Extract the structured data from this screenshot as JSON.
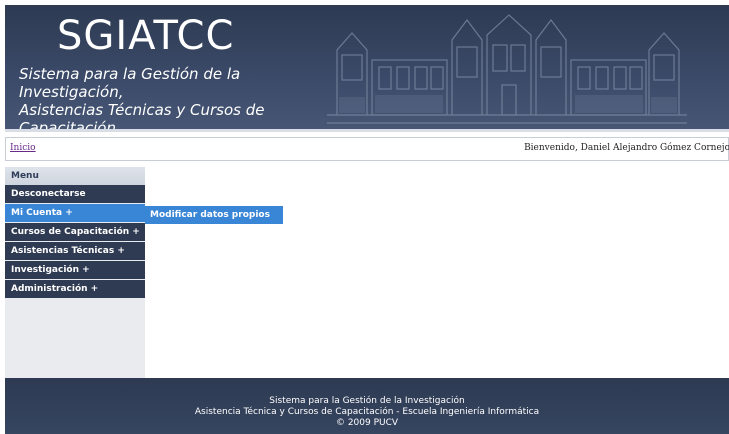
{
  "header": {
    "logo": "SGIATCC",
    "subtitle_line1": "Sistema para la Gestión de la Investigación,",
    "subtitle_line2": "Asistencias Técnicas y Cursos de Capacitación"
  },
  "breadcrumb": {
    "home_label": "Inicio",
    "welcome_text": "Bienvenido, Daniel Alejandro Gómez Cornejo"
  },
  "sidebar": {
    "title": "Menu",
    "items": [
      {
        "label": "Desconectarse",
        "active": false
      },
      {
        "label": "Mi Cuenta +",
        "active": true
      },
      {
        "label": "Cursos de Capacitación +",
        "active": false
      },
      {
        "label": "Asistencias Técnicas +",
        "active": false
      },
      {
        "label": "Investigación +",
        "active": false
      },
      {
        "label": "Administración +",
        "active": false
      }
    ]
  },
  "submenu": {
    "items": [
      {
        "label": "Modificar datos propios"
      }
    ]
  },
  "footer": {
    "line1": "Sistema para la Gestión de la Investigación",
    "line2": "Asistencia Técnica y Cursos de Capacitación - Escuela Ingeniería Informática",
    "line3": "© 2009 PUCV"
  },
  "colors": {
    "header_bg": "#3a4967",
    "menu_item_bg": "#2f3b52",
    "menu_active_bg": "#3a86d6",
    "sidebar_bg": "#e9ebef",
    "link_color": "#6a2a8a"
  }
}
